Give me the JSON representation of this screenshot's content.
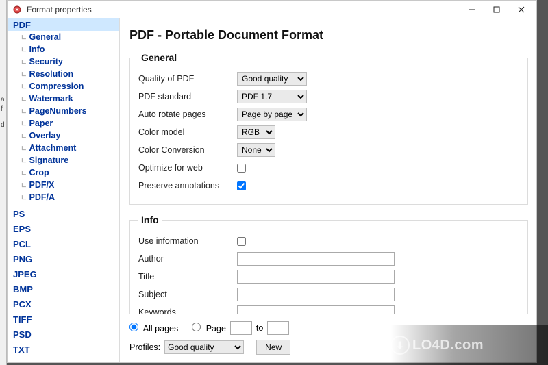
{
  "window": {
    "title": "Format properties"
  },
  "sidebar": {
    "items": [
      {
        "label": "PDF",
        "selected": true,
        "children": [
          {
            "label": "General"
          },
          {
            "label": "Info"
          },
          {
            "label": "Security"
          },
          {
            "label": "Resolution"
          },
          {
            "label": "Compression"
          },
          {
            "label": "Watermark"
          },
          {
            "label": "PageNumbers"
          },
          {
            "label": "Paper"
          },
          {
            "label": "Overlay"
          },
          {
            "label": "Attachment"
          },
          {
            "label": "Signature"
          },
          {
            "label": "Crop"
          },
          {
            "label": "PDF/X"
          },
          {
            "label": "PDF/A"
          }
        ]
      },
      {
        "label": "PS"
      },
      {
        "label": "EPS"
      },
      {
        "label": "PCL"
      },
      {
        "label": "PNG"
      },
      {
        "label": "JPEG"
      },
      {
        "label": "BMP"
      },
      {
        "label": "PCX"
      },
      {
        "label": "TIFF"
      },
      {
        "label": "PSD"
      },
      {
        "label": "TXT"
      }
    ]
  },
  "page": {
    "title": "PDF - Portable Document Format"
  },
  "general": {
    "legend": "General",
    "quality_label": "Quality of PDF",
    "quality_value": "Good quality",
    "standard_label": "PDF standard",
    "standard_value": "PDF 1.7",
    "autorotate_label": "Auto rotate pages",
    "autorotate_value": "Page by page",
    "colormodel_label": "Color model",
    "colormodel_value": "RGB",
    "colorconv_label": "Color Conversion",
    "colorconv_value": "None",
    "optimize_label": "Optimize for web",
    "optimize_checked": false,
    "preserve_label": "Preserve annotations",
    "preserve_checked": true
  },
  "info": {
    "legend": "Info",
    "useinfo_label": "Use information",
    "useinfo_checked": false,
    "author_label": "Author",
    "author_value": "",
    "title_label": "Title",
    "title_value": "",
    "subject_label": "Subject",
    "subject_value": "",
    "keywords_label": "Keywords",
    "keywords_value": ""
  },
  "bottom": {
    "allpages_label": "All pages",
    "page_label": "Page",
    "to_label": "to",
    "page_from": "",
    "page_to": "",
    "profiles_label": "Profiles:",
    "profiles_value": "Good quality",
    "new_label": "New"
  },
  "watermark": "LO4D.com"
}
